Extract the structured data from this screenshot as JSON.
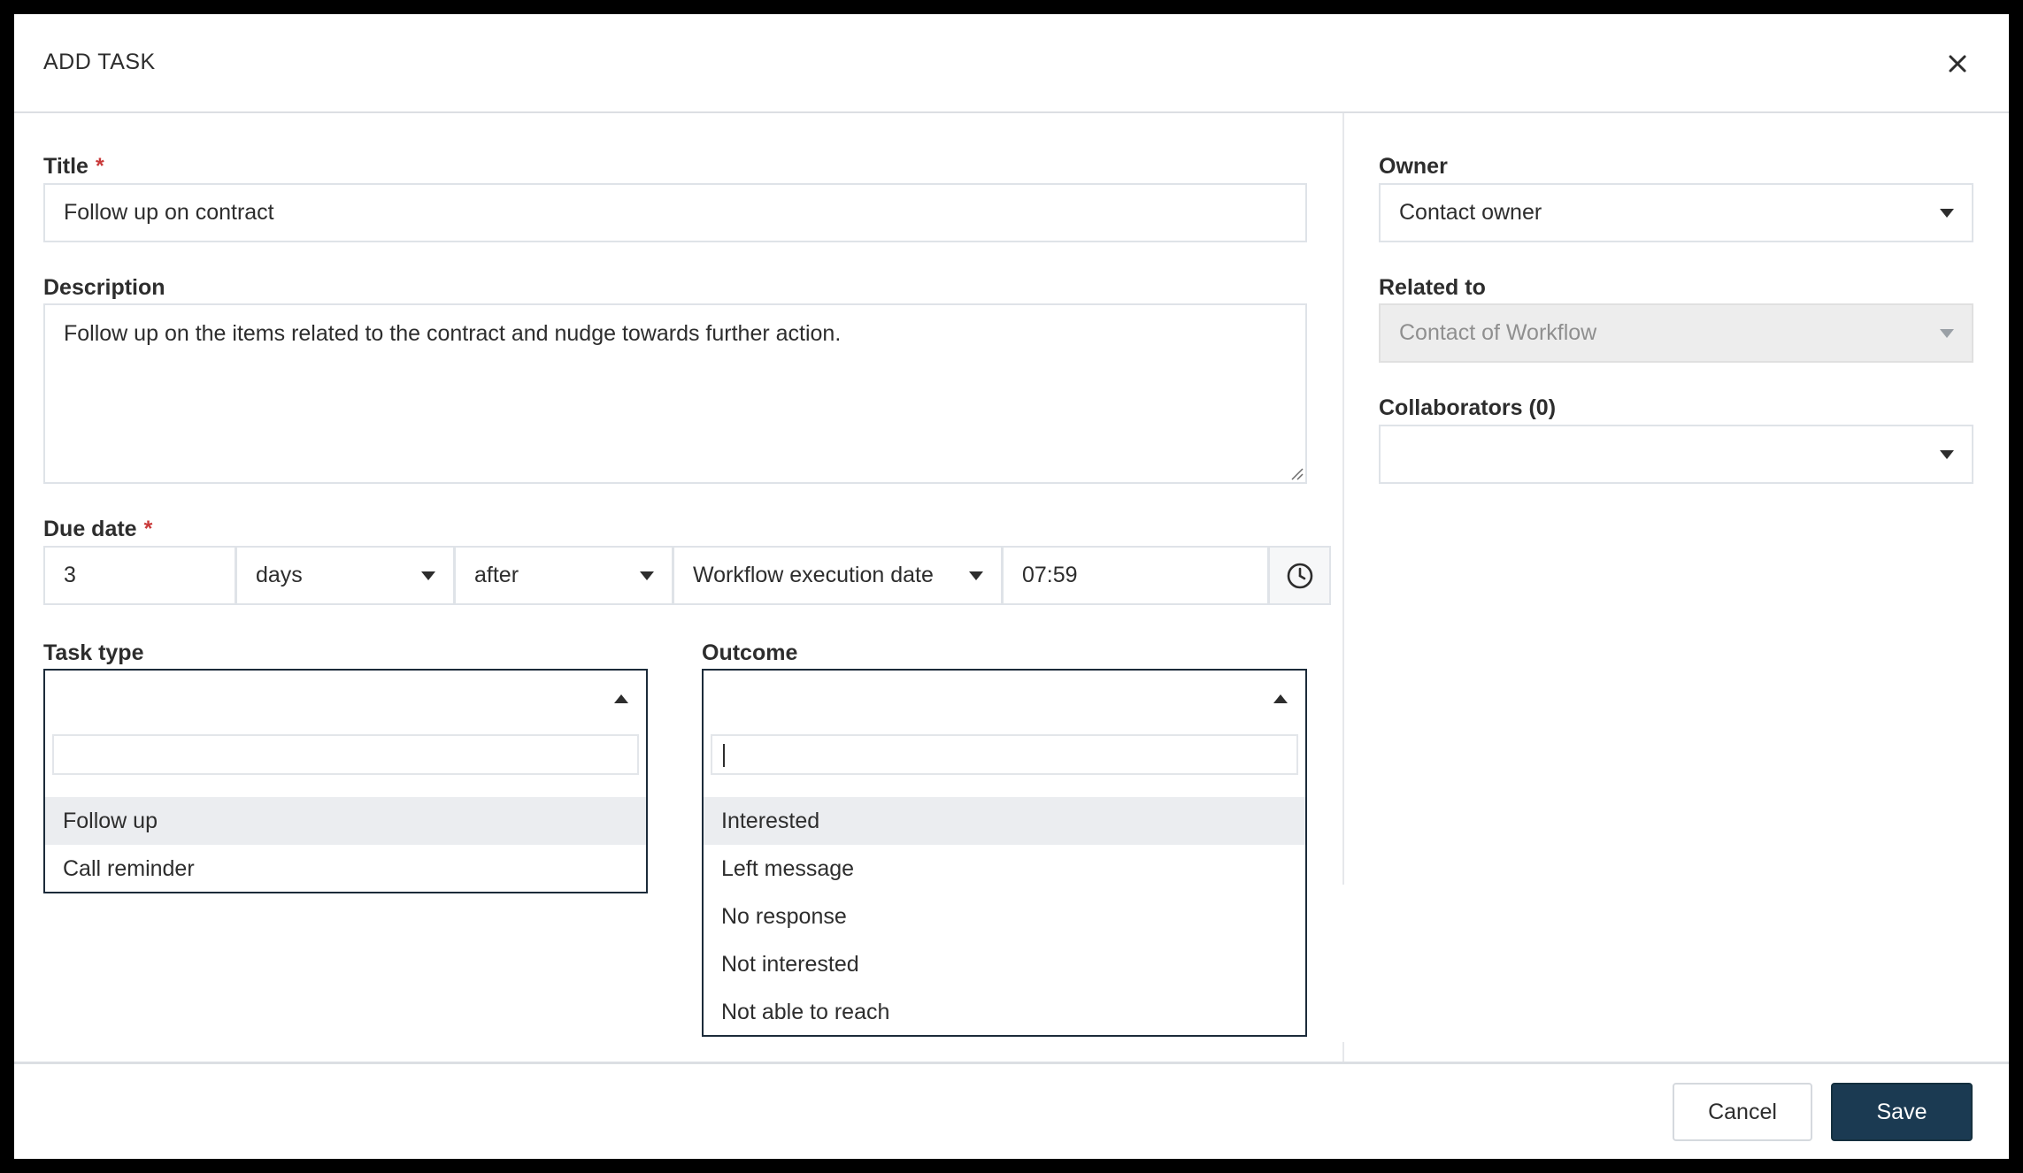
{
  "dialog": {
    "title": "ADD TASK"
  },
  "form": {
    "title": {
      "label": "Title",
      "required_mark": "*",
      "value": "Follow up on contract"
    },
    "description": {
      "label": "Description",
      "value": "Follow up on the items related to the contract and nudge towards further action."
    },
    "due_date": {
      "label": "Due date",
      "required_mark": "*",
      "amount": "3",
      "unit": "days",
      "relation": "after",
      "anchor": "Workflow execution date",
      "time": "07:59"
    },
    "task_type": {
      "label": "Task type",
      "selected": "",
      "search": "",
      "options": [
        "Follow up",
        "Call reminder"
      ]
    },
    "outcome": {
      "label": "Outcome",
      "selected": "",
      "search": "",
      "options": [
        "Interested",
        "Left message",
        "No response",
        "Not interested",
        "Not able to reach"
      ]
    },
    "owner": {
      "label": "Owner",
      "value": "Contact owner"
    },
    "related_to": {
      "label": "Related to",
      "value": "Contact of Workflow"
    },
    "collaborators": {
      "label": "Collaborators (0)",
      "value": ""
    }
  },
  "footer": {
    "cancel_label": "Cancel",
    "save_label": "Save"
  },
  "colors": {
    "primary": "#1b3a52",
    "required": "#c93a3a",
    "highlight": "#ebedf0",
    "border": "#dfe3e8"
  }
}
